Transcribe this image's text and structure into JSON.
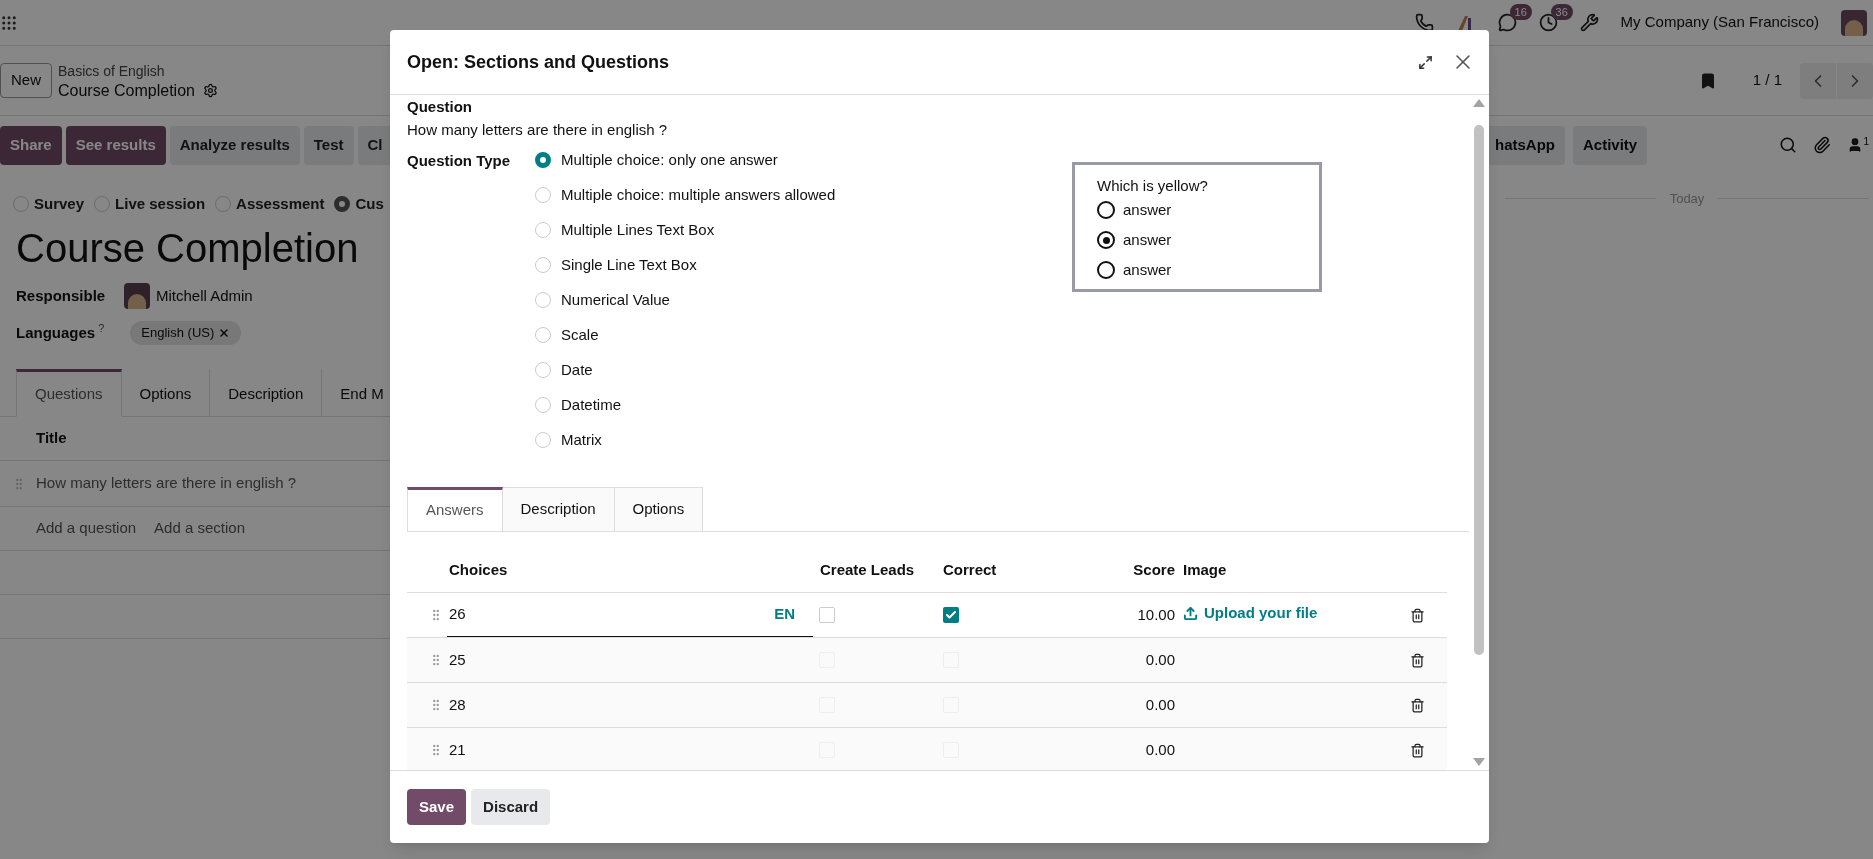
{
  "top_bar": {
    "icons": [
      {
        "kind": "phone"
      },
      {
        "kind": "ai"
      },
      {
        "kind": "chat",
        "badge": "16"
      },
      {
        "kind": "activity",
        "badge": "36"
      },
      {
        "kind": "tools"
      }
    ],
    "company": "My Company (San Francisco)"
  },
  "control_panel": {
    "new_button": "New",
    "breadcrumb_parent": "Basics of English",
    "breadcrumb_current": "Course Completion",
    "pager": "1 / 1"
  },
  "action_buttons": [
    {
      "label": "Share",
      "kind": "primary"
    },
    {
      "label": "See results",
      "kind": "primary"
    },
    {
      "label": "Analyze results",
      "kind": "secondary"
    },
    {
      "label": "Test",
      "kind": "secondary"
    },
    {
      "label": "Cl",
      "kind": "secondary"
    }
  ],
  "chatter": {
    "buttons": [
      "hatsApp",
      "Activity"
    ],
    "follower_count": "1",
    "date_separator": "Today"
  },
  "form": {
    "survey_types": [
      {
        "label": "Survey",
        "selected": false
      },
      {
        "label": "Live session",
        "selected": false
      },
      {
        "label": "Assessment",
        "selected": false
      },
      {
        "label": "Cus",
        "selected": true
      }
    ],
    "title": "Course Completion",
    "responsible": {
      "label": "Responsible",
      "value": "Mitchell Admin"
    },
    "languages": {
      "label": "Languages",
      "help": "?",
      "tags": [
        "English (US)"
      ]
    },
    "tabs": [
      {
        "label": "Questions",
        "selected": true
      },
      {
        "label": "Options",
        "selected": false
      },
      {
        "label": "Description",
        "selected": false
      },
      {
        "label": "End M",
        "selected": false
      }
    ],
    "table": {
      "columns": [
        "Title"
      ],
      "rows": [
        "How many letters are there in english ?"
      ],
      "add_links": [
        "Add a question",
        "Add a section"
      ]
    }
  },
  "dialog": {
    "title": "Open: Sections and Questions",
    "question_label": "Question",
    "question": "How many letters are there in english ?",
    "question_type_label": "Question Type",
    "question_types": [
      {
        "label": "Multiple choice: only one answer",
        "selected": true
      },
      {
        "label": "Multiple choice: multiple answers allowed",
        "selected": false
      },
      {
        "label": "Multiple Lines Text Box",
        "selected": false
      },
      {
        "label": "Single Line Text Box",
        "selected": false
      },
      {
        "label": "Numerical Value",
        "selected": false
      },
      {
        "label": "Scale",
        "selected": false
      },
      {
        "label": "Date",
        "selected": false
      },
      {
        "label": "Datetime",
        "selected": false
      },
      {
        "label": "Matrix",
        "selected": false
      }
    ],
    "preview": {
      "title": "Which is yellow?",
      "options": [
        {
          "label": "answer",
          "selected": false
        },
        {
          "label": "answer",
          "selected": true
        },
        {
          "label": "answer",
          "selected": false
        }
      ]
    },
    "tabs": [
      {
        "label": "Answers",
        "selected": true
      },
      {
        "label": "Description",
        "selected": false
      },
      {
        "label": "Options",
        "selected": false
      }
    ],
    "answers": {
      "columns": [
        "Choices",
        "Create Leads",
        "Correct",
        "Score",
        "Image"
      ],
      "rows": [
        {
          "choice": "26",
          "editing": true,
          "language": "EN",
          "create_leads": false,
          "correct": true,
          "score": "10.00",
          "image_action": "Upload your file"
        },
        {
          "choice": "25",
          "editing": false,
          "create_leads": false,
          "correct": false,
          "score": "0.00"
        },
        {
          "choice": "28",
          "editing": false,
          "create_leads": false,
          "correct": false,
          "score": "0.00"
        },
        {
          "choice": "21",
          "editing": false,
          "create_leads": false,
          "correct": false,
          "score": "0.00"
        }
      ]
    },
    "buttons": [
      {
        "label": "Save",
        "kind": "primary"
      },
      {
        "label": "Discard",
        "kind": "secondary"
      }
    ]
  }
}
